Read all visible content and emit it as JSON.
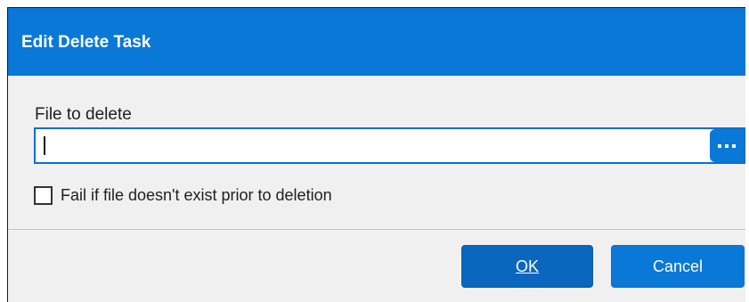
{
  "window": {
    "title": "Edit Delete Task"
  },
  "form": {
    "file_label": "File to delete",
    "file_value": "",
    "file_placeholder": "",
    "browse_icon": "ellipsis-icon",
    "checkbox_label": "Fail if file doesn't exist prior to deletion",
    "checkbox_checked": false
  },
  "buttons": {
    "ok_label": "OK",
    "cancel_label": "Cancel"
  },
  "colors": {
    "title_bar": "#0a78d7",
    "primary_button": "#0b67bd",
    "secondary_button": "#0a78d7",
    "input_border": "#0a6fd0",
    "dialog_bg": "#f0f0f0"
  }
}
